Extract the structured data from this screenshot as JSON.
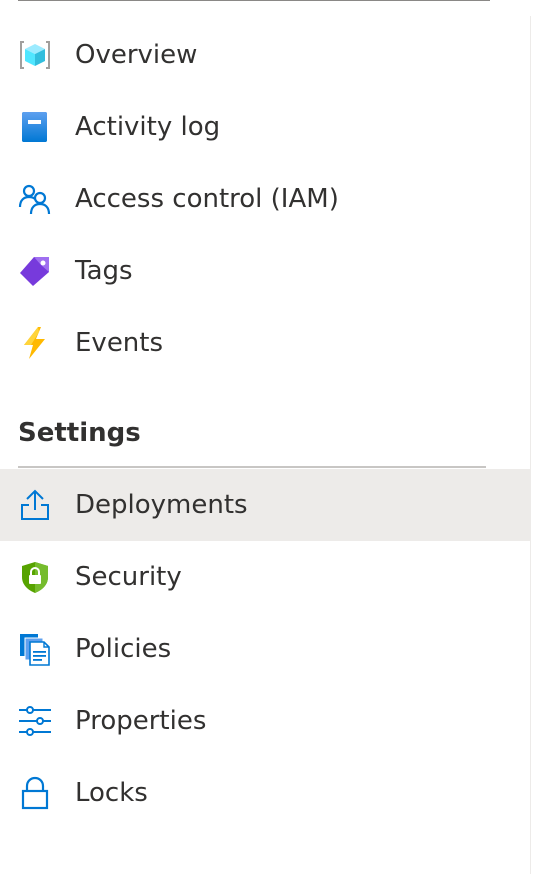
{
  "menu": {
    "items_top": [
      {
        "label": "Overview",
        "icon": "cube-icon"
      },
      {
        "label": "Activity log",
        "icon": "book-icon"
      },
      {
        "label": "Access control (IAM)",
        "icon": "people-icon"
      },
      {
        "label": "Tags",
        "icon": "tag-icon"
      },
      {
        "label": "Events",
        "icon": "lightning-icon"
      }
    ],
    "settings_section": {
      "title": "Settings",
      "items": [
        {
          "label": "Deployments",
          "icon": "upload-icon",
          "selected": true
        },
        {
          "label": "Security",
          "icon": "shield-lock-icon"
        },
        {
          "label": "Policies",
          "icon": "documents-icon"
        },
        {
          "label": "Properties",
          "icon": "sliders-icon"
        },
        {
          "label": "Locks",
          "icon": "lock-icon"
        }
      ]
    }
  },
  "colors": {
    "selected_background": "#edebe9",
    "text": "#323130",
    "azure_blue": "#0078d4",
    "divider": "#c8c6c4"
  }
}
